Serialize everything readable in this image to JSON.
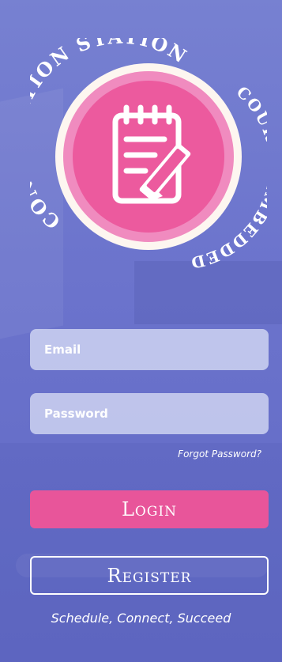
{
  "logo": {
    "arc_text_top": "CONSULTATION STATION",
    "arc_text_right": "COURSE-EMBEDDED",
    "icon": "notepad-pencil-icon",
    "colors": {
      "ring": "#fdf6f0",
      "inner_ring": "#f08bbf",
      "center": "#ec5a9e"
    }
  },
  "form": {
    "email_placeholder": "Email",
    "password_placeholder": "Password",
    "forgot_password": "Forgot Password?"
  },
  "buttons": {
    "login": "Login",
    "register": "Register"
  },
  "tagline": "Schedule, Connect, Succeed",
  "colors": {
    "accent": "#e8559a",
    "background": "#6b73c8"
  }
}
